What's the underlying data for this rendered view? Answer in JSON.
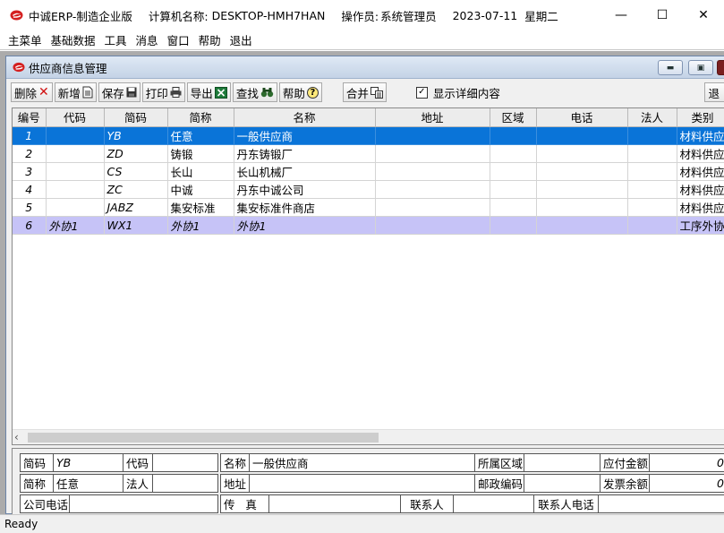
{
  "titlebar": {
    "app_name": "中诚ERP-制造企业版",
    "computer_label": "计算机名称:",
    "computer_name": "DESKTOP-HMH7HAN",
    "operator_label": "操作员:",
    "operator": "系统管理员",
    "date": "2023-07-11",
    "weekday": "星期二"
  },
  "menu": [
    "主菜单",
    "基础数据",
    "工具",
    "消息",
    "窗口",
    "帮助",
    "退出"
  ],
  "child_window": {
    "title": "供应商信息管理"
  },
  "toolbar": {
    "delete": "删除",
    "new": "新增",
    "save": "保存",
    "print": "打印",
    "export": "导出",
    "find": "查找",
    "help": "帮助",
    "merge": "合并",
    "show_detail": "显示详细内容",
    "show_detail_checked": true,
    "exit": "退"
  },
  "table": {
    "columns": [
      "编号",
      "代码",
      "简码",
      "简称",
      "名称",
      "地址",
      "区域",
      "电话",
      "法人",
      "类别"
    ],
    "rows": [
      {
        "no": "1",
        "code": "",
        "short_code": "YB",
        "abbr": "任意",
        "name": "一般供应商",
        "address": "",
        "region": "",
        "phone": "",
        "legal": "",
        "category": "材料供应"
      },
      {
        "no": "2",
        "code": "",
        "short_code": "ZD",
        "abbr": "铸锻",
        "name": "丹东铸锻厂",
        "address": "",
        "region": "",
        "phone": "",
        "legal": "",
        "category": "材料供应"
      },
      {
        "no": "3",
        "code": "",
        "short_code": "CS",
        "abbr": "长山",
        "name": "长山机械厂",
        "address": "",
        "region": "",
        "phone": "",
        "legal": "",
        "category": "材料供应"
      },
      {
        "no": "4",
        "code": "",
        "short_code": "ZC",
        "abbr": "中诚",
        "name": "丹东中诚公司",
        "address": "",
        "region": "",
        "phone": "",
        "legal": "",
        "category": "材料供应"
      },
      {
        "no": "5",
        "code": "",
        "short_code": "JABZ",
        "abbr": "集安标准",
        "name": "集安标准件商店",
        "address": "",
        "region": "",
        "phone": "",
        "legal": "",
        "category": "材料供应"
      },
      {
        "no": "6",
        "code": "外协1",
        "short_code": "WX1",
        "abbr": "外协1",
        "name": "外协1",
        "address": "",
        "region": "",
        "phone": "",
        "legal": "",
        "category": "工序外协"
      }
    ]
  },
  "detail": {
    "short_code_label": "简码",
    "short_code": "YB",
    "code_label": "代码",
    "code": "",
    "name_label": "名称",
    "name": "一般供应商",
    "region_label": "所属区域",
    "region": "",
    "payable_label": "应付金额",
    "payable": "0",
    "abbr_label": "简称",
    "abbr": "任意",
    "legal_label": "法人",
    "legal": "",
    "address_label": "地址",
    "address": "",
    "postcode_label": "邮政编码",
    "postcode": "",
    "invoice_label": "发票余额",
    "invoice": "0",
    "phone_label": "公司电话",
    "phone": "",
    "fax_label": "传   真",
    "fax": "",
    "contact_label": "联系人",
    "contact": "",
    "contact_phone_label": "联系人电话",
    "contact_phone": ""
  },
  "status": "Ready",
  "colors": {
    "selected_row": "#0a74d8",
    "highlight_row": "#c6c3f7",
    "logo_red": "#d42020"
  }
}
